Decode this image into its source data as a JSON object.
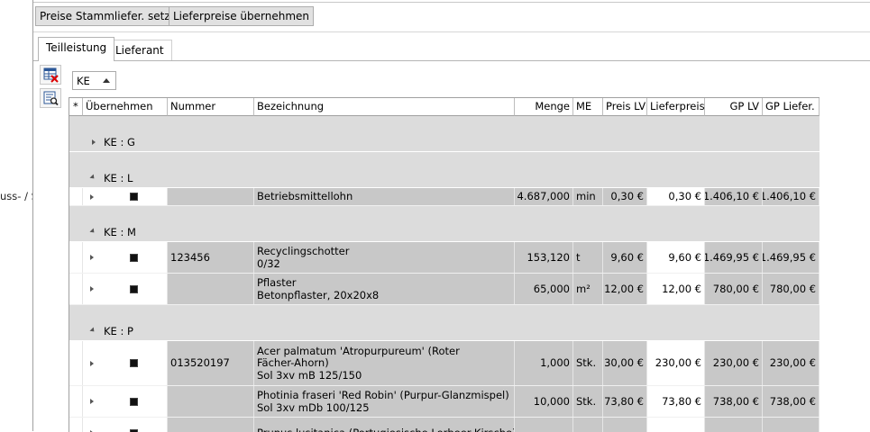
{
  "left_pane": {
    "cut_text": "uss- / S"
  },
  "toolbar": {
    "set_prices_label": "Preise Stammliefer. setzen",
    "take_prices_label": "Lieferpreise übernehmen"
  },
  "tabs": [
    {
      "label": "Teilleistung",
      "active": true
    },
    {
      "label": "Lieferant",
      "active": false
    }
  ],
  "filter": {
    "value": "KE"
  },
  "grid": {
    "columns": [
      "*",
      "Übernehmen",
      "Nummer",
      "Bezeichnung",
      "Menge",
      "ME",
      "Preis LV",
      "Lieferpreis",
      "GP LV",
      "GP Liefer."
    ],
    "groups": [
      {
        "label": "KE : G",
        "expanded": false,
        "rows": []
      },
      {
        "label": "KE : L",
        "expanded": true,
        "rows": [
          {
            "nummer": "",
            "bezeichnung": [
              "Betriebsmittellohn"
            ],
            "menge": "4.687,000",
            "me": "min",
            "preis_lv": "0,30 €",
            "lieferpreis": "0,30 €",
            "gp_lv": "1.406,10 €",
            "gp_liefer": "1.406,10 €"
          }
        ]
      },
      {
        "label": "KE : M",
        "expanded": true,
        "rows": [
          {
            "nummer": "123456",
            "bezeichnung": [
              "Recyclingschotter",
              "0/32"
            ],
            "menge": "153,120",
            "me": "t",
            "preis_lv": "9,60 €",
            "lieferpreis": "9,60 €",
            "gp_lv": "1.469,95 €",
            "gp_liefer": "1.469,95 €"
          },
          {
            "nummer": "",
            "bezeichnung": [
              "Pflaster",
              "Betonpflaster, 20x20x8"
            ],
            "menge": "65,000",
            "me": "m²",
            "preis_lv": "12,00 €",
            "lieferpreis": "12,00 €",
            "gp_lv": "780,00 €",
            "gp_liefer": "780,00 €"
          }
        ]
      },
      {
        "label": "KE : P",
        "expanded": true,
        "rows": [
          {
            "nummer": "013520197",
            "bezeichnung": [
              "Acer palmatum 'Atropurpureum' (Roter",
              "Fächer-Ahorn)",
              "Sol 3xv mB 125/150"
            ],
            "menge": "1,000",
            "me": "Stk.",
            "preis_lv": "230,00 €",
            "lieferpreis": "230,00 €",
            "gp_lv": "230,00 €",
            "gp_liefer": "230,00 €"
          },
          {
            "nummer": "",
            "bezeichnung": [
              "Photinia fraseri 'Red Robin' (Purpur-Glanzmispel)",
              "Sol 3xv mDb 100/125"
            ],
            "menge": "10,000",
            "me": "Stk.",
            "preis_lv": "73,80 €",
            "lieferpreis": "73,80 €",
            "gp_lv": "738,00 €",
            "gp_liefer": "738,00 €"
          },
          {
            "nummer": "",
            "bezeichnung": [
              "Prunus lusitanica (Portugiesische Lorbeer-Kirsche)"
            ],
            "menge": "",
            "me": "",
            "preis_lv": "",
            "lieferpreis": "",
            "gp_lv": "",
            "gp_liefer": ""
          }
        ]
      }
    ]
  }
}
